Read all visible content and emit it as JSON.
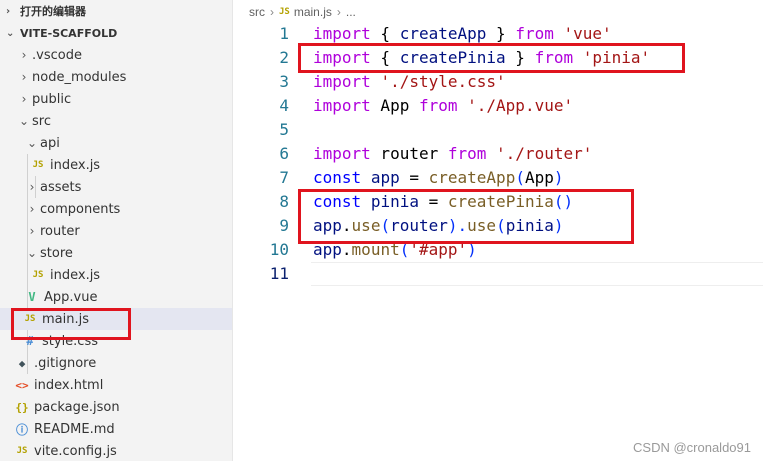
{
  "explorer": {
    "open_editors_label": "打开的编辑器",
    "project_label": "VITE-SCAFFOLD",
    "items": [
      {
        "label": ".vscode",
        "icon": "folder-closed",
        "depth": 0
      },
      {
        "label": "node_modules",
        "icon": "folder-closed",
        "depth": 0
      },
      {
        "label": "public",
        "icon": "folder-closed",
        "depth": 0
      },
      {
        "label": "src",
        "icon": "folder-open",
        "depth": 0
      },
      {
        "label": "api",
        "icon": "folder-open",
        "depth": 1
      },
      {
        "label": "index.js",
        "icon": "js-file",
        "depth": 2
      },
      {
        "label": "assets",
        "icon": "folder-closed",
        "depth": 1
      },
      {
        "label": "components",
        "icon": "folder-closed",
        "depth": 1
      },
      {
        "label": "router",
        "icon": "folder-closed",
        "depth": 1
      },
      {
        "label": "store",
        "icon": "folder-open",
        "depth": 1
      },
      {
        "label": "index.js",
        "icon": "js-file",
        "depth": 2
      },
      {
        "label": "App.vue",
        "icon": "vue-file",
        "depth": 1
      },
      {
        "label": "main.js",
        "icon": "js-file",
        "depth": 1,
        "selected": true
      },
      {
        "label": "style.css",
        "icon": "css-file",
        "depth": 1
      },
      {
        "label": ".gitignore",
        "icon": "git-file",
        "depth": 0
      },
      {
        "label": "index.html",
        "icon": "html-file",
        "depth": 0
      },
      {
        "label": "package.json",
        "icon": "json-file",
        "depth": 0
      },
      {
        "label": "README.md",
        "icon": "info-file",
        "depth": 0
      },
      {
        "label": "vite.config.js",
        "icon": "js-file",
        "depth": 0
      }
    ]
  },
  "breadcrumb": {
    "folder": "src",
    "file": "main.js",
    "more": "..."
  },
  "editor": {
    "line_numbers": [
      "1",
      "2",
      "3",
      "4",
      "5",
      "6",
      "7",
      "8",
      "9",
      "10",
      "11"
    ],
    "lines": [
      {
        "t1": "import",
        "t2": " { ",
        "t3": "createApp",
        "t4": " } ",
        "t5": "from",
        "t6": " ",
        "t7": "'vue'"
      },
      {
        "t1": "import",
        "t2": " { ",
        "t3": "createPinia",
        "t4": " } ",
        "t5": "from",
        "t6": " ",
        "t7": "'pinia'"
      },
      {
        "t1": "import",
        "t2": " ",
        "t3": "'./style.css'"
      },
      {
        "t1": "import",
        "t2": " App ",
        "t3": "from",
        "t4": " ",
        "t5": "'./App.vue'"
      },
      {},
      {
        "t1": "import",
        "t2": " router ",
        "t3": "from",
        "t4": " ",
        "t5": "'./router'"
      },
      {
        "t1": "const",
        "t2": " ",
        "t3": "app",
        "t4": " = ",
        "t5": "createApp",
        "t6": "(",
        "t7": "App",
        "t8": ")"
      },
      {
        "t1": "const",
        "t2": " ",
        "t3": "pinia",
        "t4": " = ",
        "t5": "createPinia",
        "t6": "()"
      },
      {
        "t1": "app",
        "t2": ".",
        "t3": "use",
        "t4": "(",
        "t5": "router",
        "t6": ").",
        "t7": "use",
        "t8": "(",
        "t9": "pinia",
        "t10": ")"
      },
      {
        "t1": "app",
        "t2": ".",
        "t3": "mount",
        "t4": "(",
        "t5": "'#app'",
        "t6": ")"
      },
      {}
    ]
  },
  "colors": {
    "highlight_box": "#e0141e",
    "keyword": "#af00db",
    "string": "#a31515",
    "function": "#795e26",
    "variable": "#001080"
  },
  "watermark": "CSDN @cronaldo91"
}
